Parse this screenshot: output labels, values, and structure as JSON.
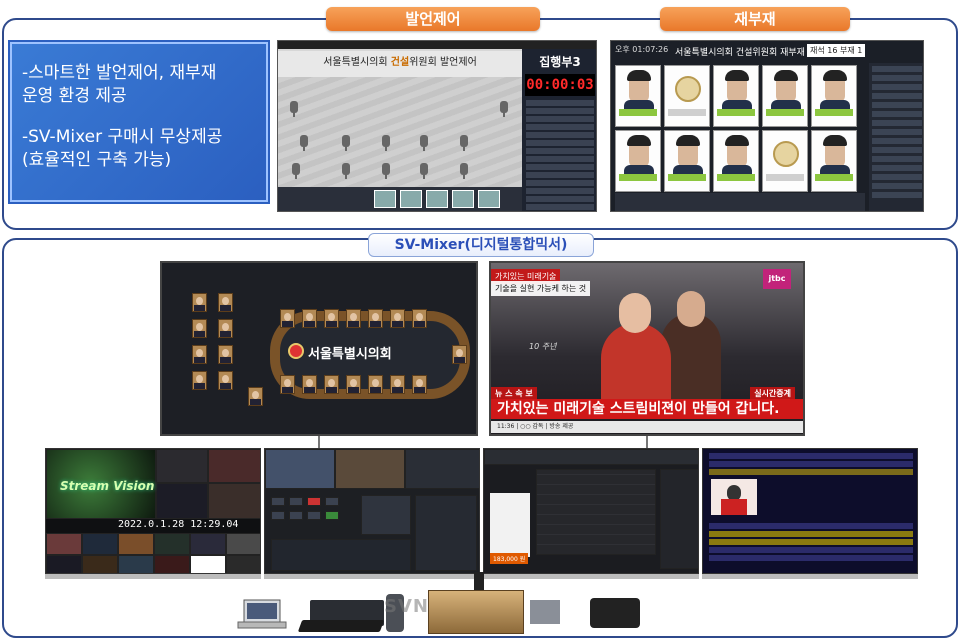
{
  "top_panel": {
    "speech_tag": "발언제어",
    "vote_tag": "재부재",
    "features": [
      "-스마트한 발언제어, 재부재",
      " 운영  환경 제공",
      "-SV-Mixer 구매시 무상제공",
      " (효율적인 구축 가능)"
    ]
  },
  "speech_screen": {
    "title_prefix": "서울특별시의회",
    "title_highlight": "건설",
    "title_suffix": "위원회 발언제어",
    "speaker_name": "집행부3",
    "timer": "00:00:03"
  },
  "vote_screen": {
    "time": "오후 01:07:26",
    "title": "서울특별시의회 건설위원회 재부재",
    "counter_a": "재석 16",
    "counter_b": "부재 1"
  },
  "bottom_panel": {
    "mixer_tag": "SV-Mixer(디지털통합믹서)",
    "council_label": "서울특별시의회",
    "broadcast": {
      "top_tag": "가치있는 미래기술",
      "top_text": "기술을 실현 가능케 하는 것",
      "logo": "jtbc",
      "side_text": "10 주년",
      "breaking_left": "뉴 스 속 보",
      "breaking_right": "실시간증계",
      "headline": "가치있는 미래기술 스트림비젼이 만들어 갑니다.",
      "ticker": "11:36  |  ○○ 감독  |  방송 제공"
    },
    "monitor1": {
      "title": "Stream Vision",
      "datetime": "2022.0.1.28 12:29.04"
    },
    "monitor3": {
      "price": "183,000 원"
    },
    "watermark": "SVN"
  }
}
